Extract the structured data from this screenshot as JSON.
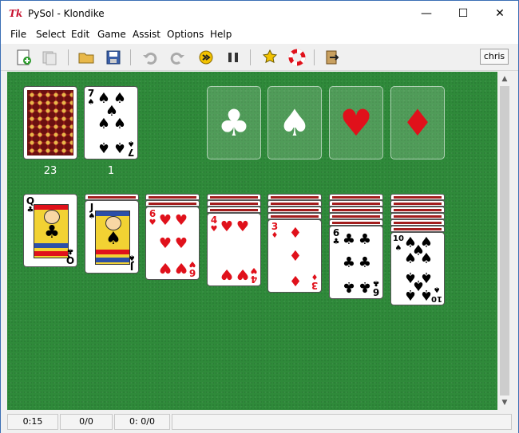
{
  "window": {
    "app_icon": "Tk",
    "title": "PySol - Klondike",
    "controls": {
      "minimize": "—",
      "maximize": "☐",
      "close": "✕"
    }
  },
  "menu": [
    "File",
    "Select",
    "Edit",
    "Game",
    "Assist",
    "Options",
    "Help"
  ],
  "toolbar": {
    "buttons": [
      {
        "name": "new-game-icon"
      },
      {
        "name": "restart-icon"
      },
      {
        "name": "open-folder-icon"
      },
      {
        "name": "save-icon"
      },
      {
        "name": "undo-icon"
      },
      {
        "name": "redo-icon"
      },
      {
        "name": "autodrop-icon"
      },
      {
        "name": "pause-icon"
      },
      {
        "name": "statistics-icon"
      },
      {
        "name": "help-ring-icon"
      },
      {
        "name": "quit-icon"
      }
    ],
    "player": "chris"
  },
  "game": {
    "stock_count": "23",
    "waste_count": "1",
    "waste_card": {
      "rank": "7",
      "suit": "♠"
    },
    "foundations": [
      {
        "suit": "♣",
        "color": "#ffffff"
      },
      {
        "suit": "♠",
        "color": "#ffffff"
      },
      {
        "suit": "♥",
        "color": "#e0111b"
      },
      {
        "suit": "♦",
        "color": "#e0111b"
      }
    ],
    "tableau": [
      {
        "rank": "Q",
        "suit": "♣"
      },
      {
        "rank": "J",
        "suit": "♠"
      },
      {
        "rank": "6",
        "suit": "♥"
      },
      {
        "rank": "4",
        "suit": "♥"
      },
      {
        "rank": "3",
        "suit": "♦"
      },
      {
        "rank": "6",
        "suit": "♣"
      },
      {
        "rank": "10",
        "suit": "♠"
      }
    ]
  },
  "status": {
    "time": "0:15",
    "moves": "0/0",
    "score": "0: 0/0"
  },
  "scrollbar": {
    "up": "▲",
    "down": "▼"
  }
}
